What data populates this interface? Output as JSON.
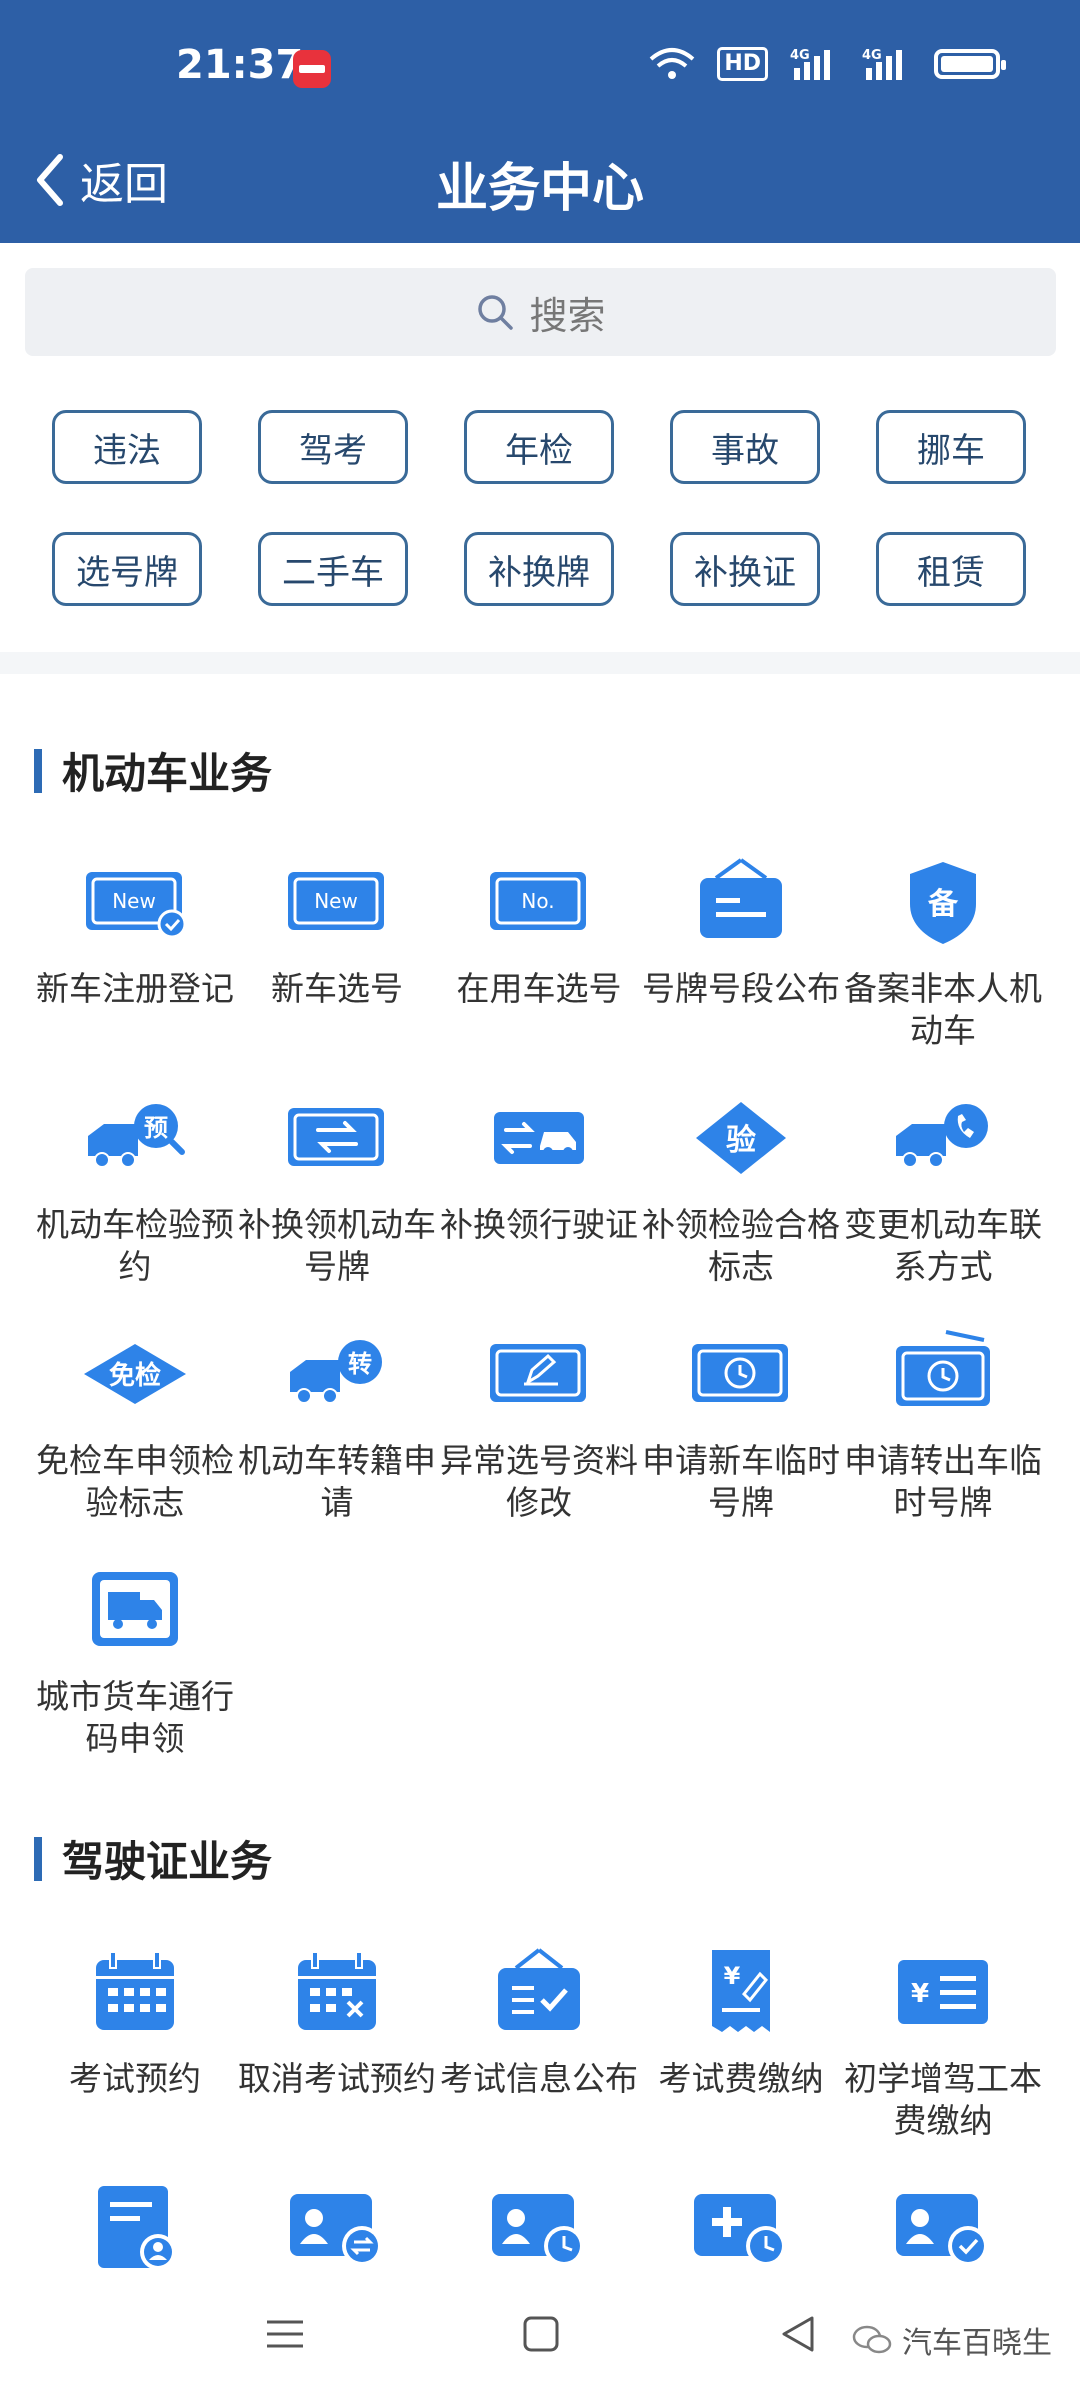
{
  "status_bar": {
    "time": "21:37",
    "hd": "HD",
    "network_1": "4G",
    "network_2": "4G"
  },
  "header": {
    "back_label": "返回",
    "title": "业务中心"
  },
  "search": {
    "placeholder": "搜索"
  },
  "quick_tags": [
    "违法",
    "驾考",
    "年检",
    "事故",
    "挪车",
    "选号牌",
    "二手车",
    "补换牌",
    "补换证",
    "租赁"
  ],
  "sections": [
    {
      "title": "机动车业务",
      "items": [
        {
          "label": "新车注册登记",
          "icon": "new-plate-check-icon"
        },
        {
          "label": "新车选号",
          "icon": "new-plate-icon"
        },
        {
          "label": "在用车选号",
          "icon": "number-plate-icon"
        },
        {
          "label": "号牌号段公布",
          "icon": "notice-board-icon"
        },
        {
          "label": "备案非本人机动车",
          "icon": "record-shield-icon"
        },
        {
          "label": "机动车检验预约",
          "icon": "truck-reserve-icon"
        },
        {
          "label": "补换领机动车号牌",
          "icon": "plate-swap-icon"
        },
        {
          "label": "补换领行驶证",
          "icon": "license-swap-icon"
        },
        {
          "label": "补领检验合格标志",
          "icon": "inspection-diamond-icon"
        },
        {
          "label": "变更机动车联系方式",
          "icon": "truck-phone-icon"
        },
        {
          "label": "免检车申领检验标志",
          "icon": "exempt-diamond-icon"
        },
        {
          "label": "机动车转籍申请",
          "icon": "truck-transfer-icon"
        },
        {
          "label": "异常选号资料修改",
          "icon": "plate-edit-icon"
        },
        {
          "label": "申请新车临时号牌",
          "icon": "temp-plate-clock-icon"
        },
        {
          "label": "申请转出车临时号牌",
          "icon": "temp-plate-clock-out-icon"
        },
        {
          "label": "城市货车通行码申领",
          "icon": "freight-truck-icon"
        }
      ]
    },
    {
      "title": "驾驶证业务",
      "items": [
        {
          "label": "考试预约",
          "icon": "calendar-icon"
        },
        {
          "label": "取消考试预约",
          "icon": "calendar-cancel-icon"
        },
        {
          "label": "考试信息公布",
          "icon": "exam-notice-icon"
        },
        {
          "label": "考试费缴纳",
          "icon": "fee-receipt-icon"
        },
        {
          "label": "初学增驾工本费缴纳",
          "icon": "fee-list-icon"
        },
        {
          "label": "",
          "icon": "document-user-icon"
        },
        {
          "label": "",
          "icon": "user-card-swap-icon"
        },
        {
          "label": "",
          "icon": "user-card-clock-icon"
        },
        {
          "label": "",
          "icon": "medical-clock-icon"
        },
        {
          "label": "",
          "icon": "user-card-check-icon"
        }
      ]
    }
  ],
  "nav_bar": {
    "watermark": "汽车百晓生"
  },
  "colors": {
    "header": "#2d5fa6",
    "accent": "#2d6bb5",
    "icon": "#2e83e8",
    "chip_border": "#3a6a98"
  }
}
